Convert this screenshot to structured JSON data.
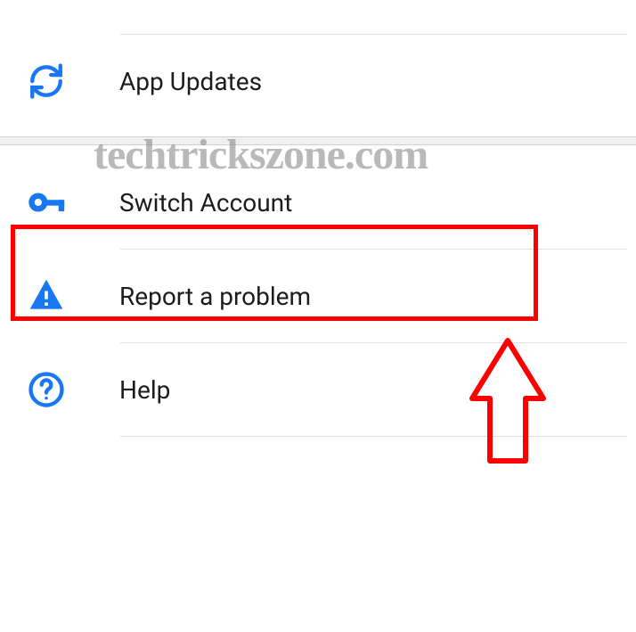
{
  "section1": {
    "app_updates": {
      "label": "App Updates"
    }
  },
  "section2": {
    "switch_account": {
      "label": "Switch Account"
    },
    "report_problem": {
      "label": "Report a problem"
    },
    "help": {
      "label": "Help"
    }
  },
  "watermark": "techtrickszone.com",
  "colors": {
    "icon_blue": "#1877f2",
    "highlight_red": "#ff0000",
    "text": "#1c1c1c"
  }
}
